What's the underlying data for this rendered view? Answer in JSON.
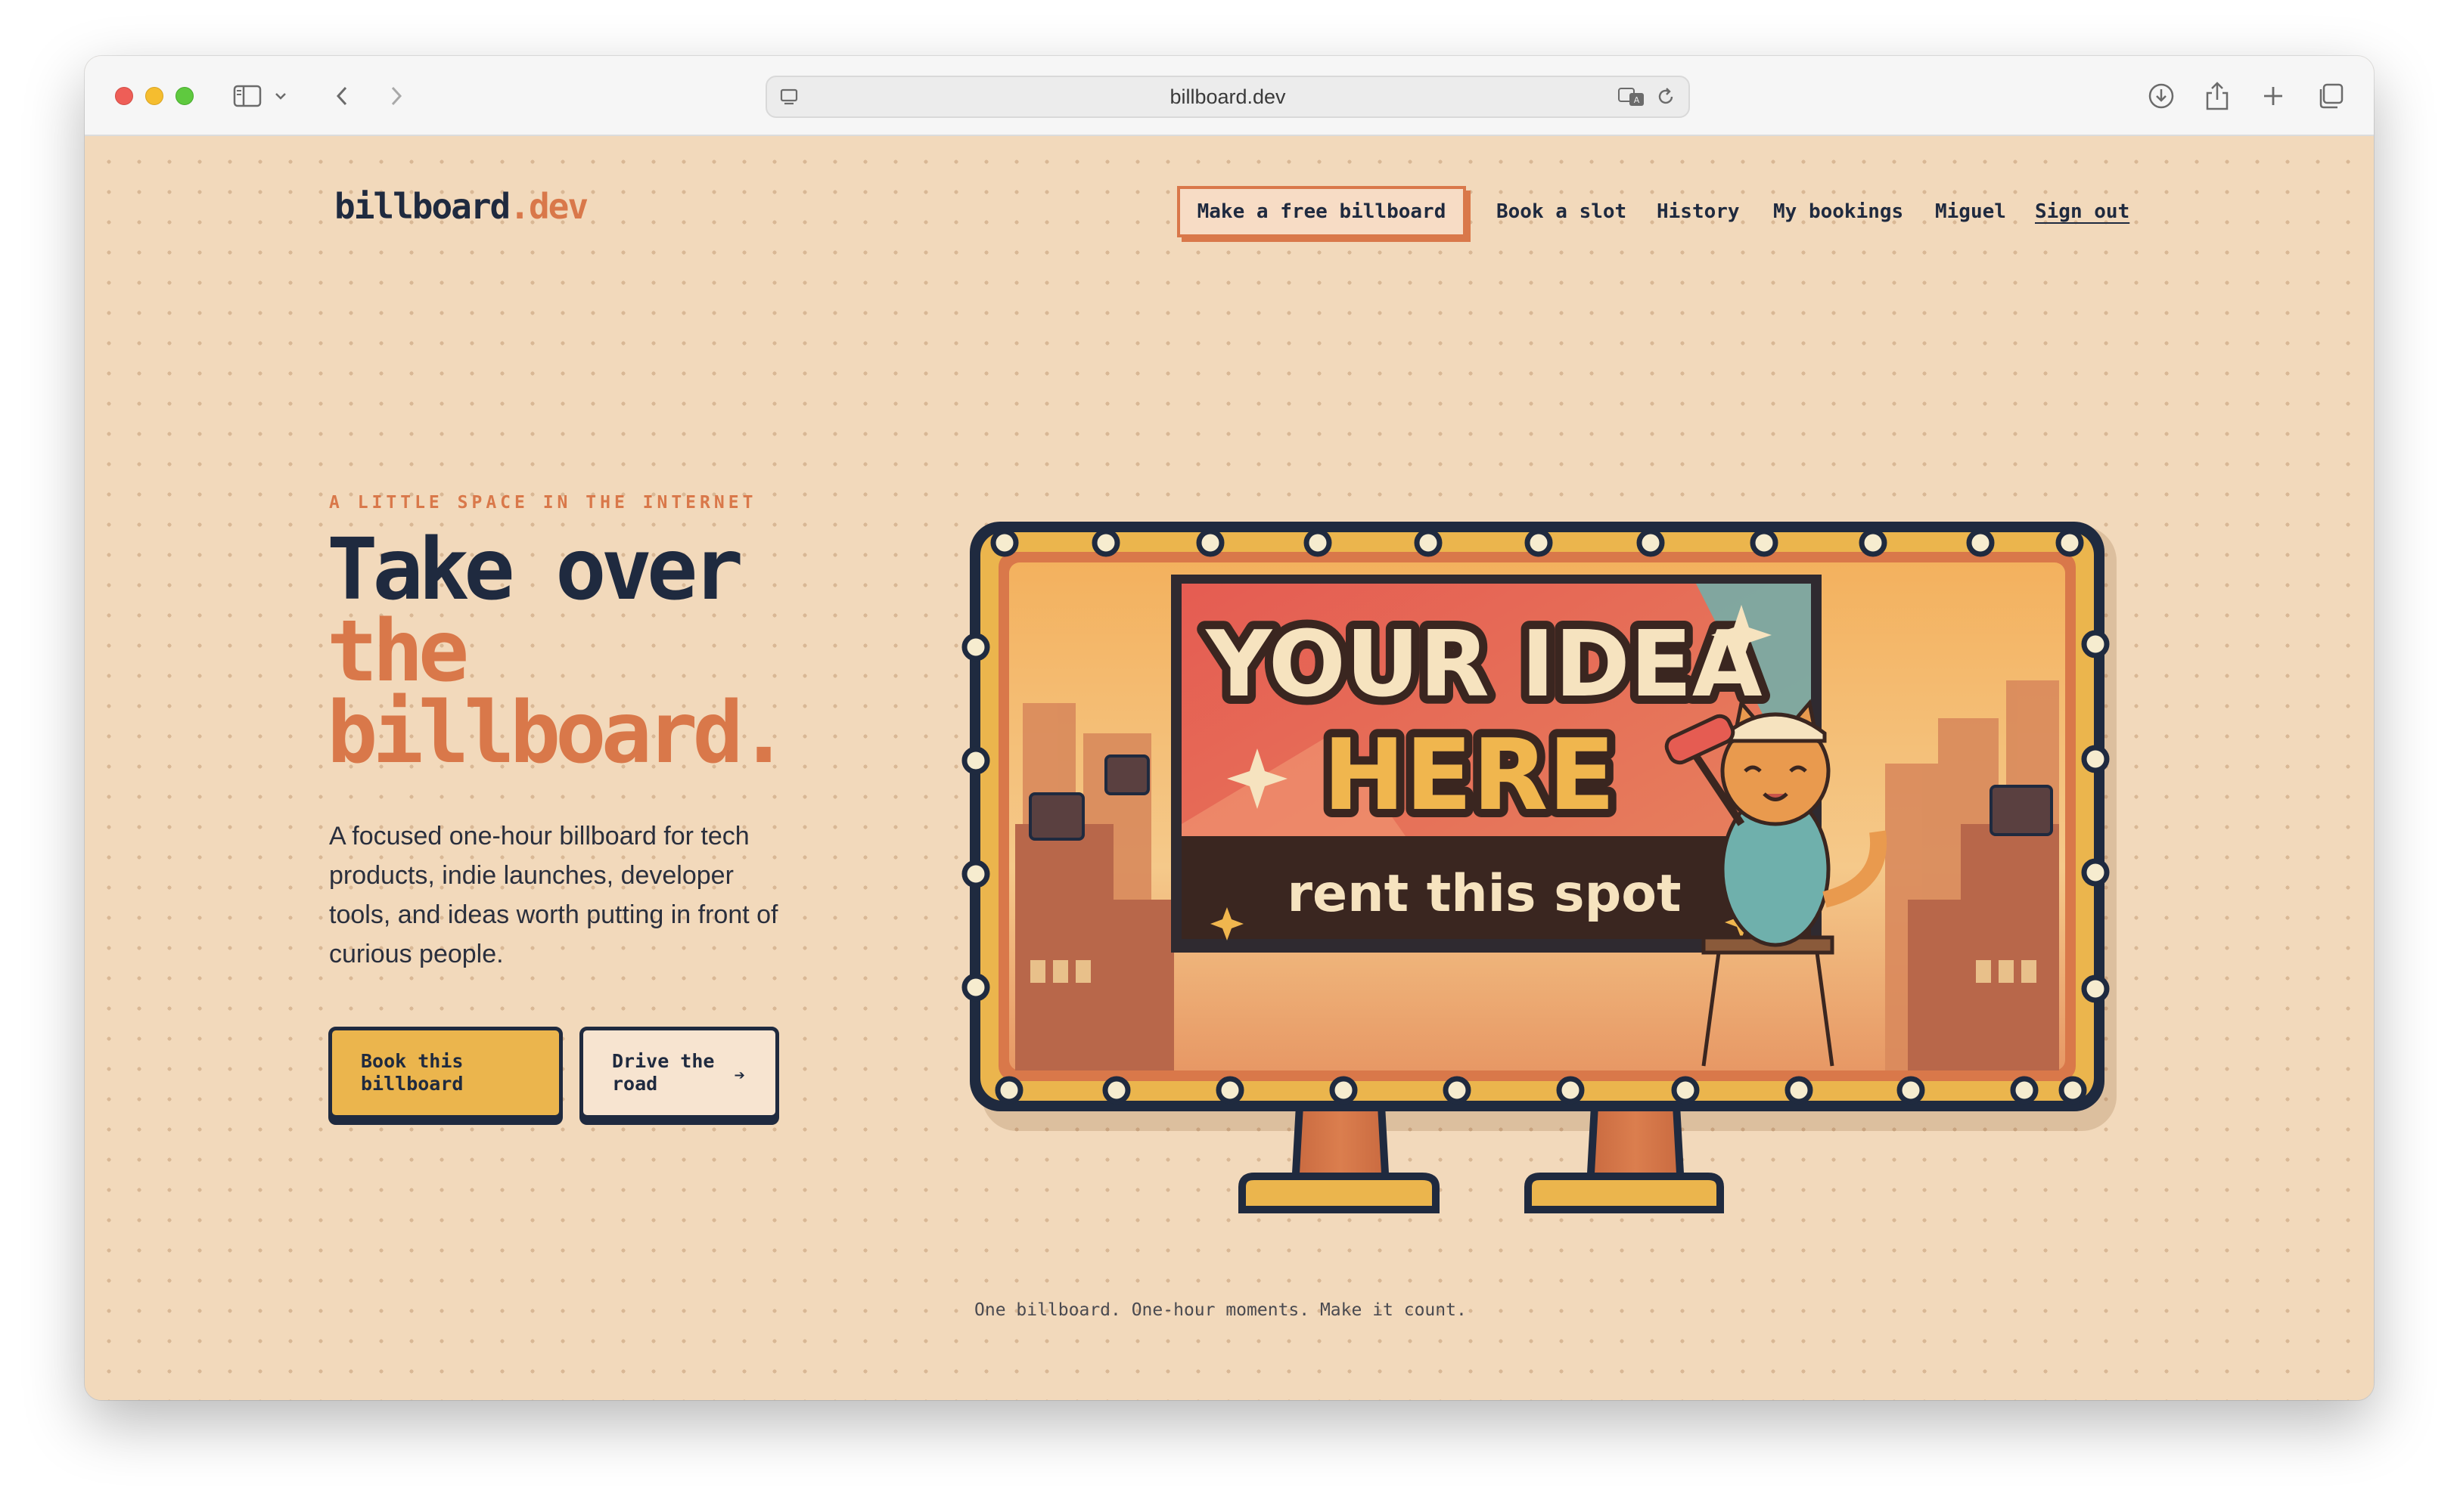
{
  "browser": {
    "url": "billboard.dev"
  },
  "site": {
    "logo_main": "billboard",
    "logo_suffix": ".dev"
  },
  "nav": {
    "cta": "Make a free billboard",
    "links": [
      "Book a slot",
      "History",
      "My bookings",
      "Miguel",
      "Sign out"
    ]
  },
  "hero": {
    "eyebrow": "A LITTLE SPACE IN THE INTERNET",
    "headline_line1": "Take over",
    "headline_line2": "the",
    "headline_line3": "billboard.",
    "description": "A focused one-hour billboard for tech products, indie launches, developer tools, and ideas worth putting in front of curious people.",
    "primary_button": "Book this billboard",
    "secondary_button": "Drive the road",
    "secondary_icon": "arrow-right-icon"
  },
  "billboard": {
    "line1": "YOUR IDEA",
    "line2": "HERE",
    "tagline": "rent this spot"
  },
  "footer": {
    "note": "One billboard. One-hour moments. Make it count."
  },
  "colors": {
    "page_bg": "#f2d9bb",
    "navy": "#1f2a3f",
    "accent_orange": "#d9784a",
    "accent_yellow": "#ebb54d"
  }
}
